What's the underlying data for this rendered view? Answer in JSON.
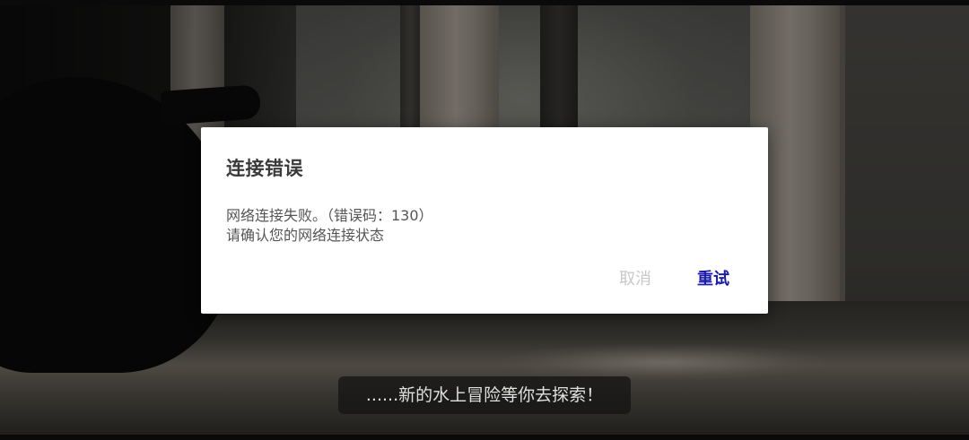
{
  "dialog": {
    "title": "连接错误",
    "message_line1": "网络连接失败。（错误码：130）",
    "message_line2": "请确认您的网络连接状态",
    "cancel_label": "取消",
    "retry_label": "重试"
  },
  "subtitle": {
    "text": "......新的水上冒险等你去探索！"
  },
  "colors": {
    "retry_accent": "#1a1ab0",
    "cancel_disabled": "#c8c8c8",
    "dialog_background": "#ffffff"
  }
}
